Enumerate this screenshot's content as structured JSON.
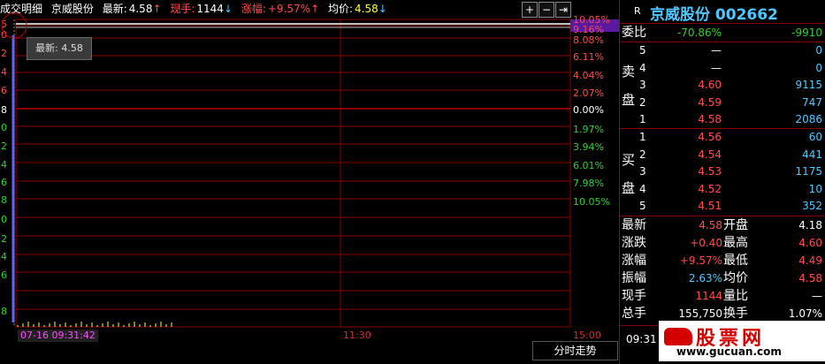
{
  "header": {
    "section": "成交明细",
    "stock_name": "京威股份",
    "latest_label": "最新:",
    "latest_value": "4.58",
    "volume_label": "现手:",
    "volume_value": "1144",
    "change_label": "涨幅:",
    "change_value": "+9.57%",
    "avg_label": "均价:",
    "avg_value": "4.58",
    "up_arrow": "↑",
    "down_arrow": "↓",
    "btn_plus": "+",
    "btn_minus": "−",
    "btn_right": "⇥"
  },
  "chart": {
    "pct_labels_red": [
      "10.05%",
      "9.16%",
      "8.08%",
      "6.11%",
      "4.04%",
      "2.07%"
    ],
    "zero_label": "0.00%",
    "pct_labels_green": [
      "1.97%",
      "3.94%",
      "6.01%",
      "7.98%",
      "10.05%"
    ],
    "left_price_fragments": [
      "5",
      "0",
      "2",
      "4",
      "6",
      "8",
      "0",
      "2",
      "4",
      "6",
      "8",
      "0",
      "2",
      "4",
      "6",
      "8"
    ],
    "cursor_time": "07-16 09:31:42",
    "mid_time": "11:30",
    "end_time": "15:00",
    "tooltip_label": "最新:",
    "tooltip_value": "4.58",
    "tab_label": "分时走势"
  },
  "panel": {
    "mode": "R",
    "title": "京威股份 002662",
    "ratio_label": "委比",
    "ratio_pct": "-70.86%",
    "ratio_diff": "-9910",
    "sell_label": [
      "卖",
      "盘"
    ],
    "buy_label": [
      "买",
      "盘"
    ],
    "sell": [
      {
        "level": "5",
        "price": "—",
        "vol": "0"
      },
      {
        "level": "4",
        "price": "—",
        "vol": "0"
      },
      {
        "level": "3",
        "price": "4.60",
        "vol": "9115"
      },
      {
        "level": "2",
        "price": "4.59",
        "vol": "747"
      },
      {
        "level": "1",
        "price": "4.58",
        "vol": "2086"
      }
    ],
    "buy": [
      {
        "level": "1",
        "price": "4.56",
        "vol": "60"
      },
      {
        "level": "2",
        "price": "4.54",
        "vol": "441"
      },
      {
        "level": "3",
        "price": "4.53",
        "vol": "1175"
      },
      {
        "level": "4",
        "price": "4.52",
        "vol": "10"
      },
      {
        "level": "5",
        "price": "4.51",
        "vol": "352"
      }
    ],
    "stats": [
      {
        "l1": "最新",
        "v1": "4.58",
        "l2": "开盘",
        "v2": "4.18"
      },
      {
        "l1": "涨跌",
        "v1": "+0.40",
        "l2": "最高",
        "v2": "4.60"
      },
      {
        "l1": "涨幅",
        "v1": "+9.57%",
        "l2": "最低",
        "v2": "4.49"
      },
      {
        "l1": "振幅",
        "v1": "2.63%",
        "l2": "均价",
        "v2": "4.58"
      },
      {
        "l1": "现手",
        "v1": "1144",
        "l2": "量比",
        "v2": "—"
      },
      {
        "l1": "总手",
        "v1": "155,750",
        "l2": "换手",
        "v2": "1.07%"
      }
    ],
    "time": "09:31",
    "watermark_text": "股票网",
    "watermark_url": "www.gucuan.com"
  },
  "colors": {
    "grid": "#8a0000",
    "price_line": "#ffffff",
    "avg_line": "#ffff3c",
    "up": "#ff4b4b",
    "down": "#2fd02f"
  }
}
